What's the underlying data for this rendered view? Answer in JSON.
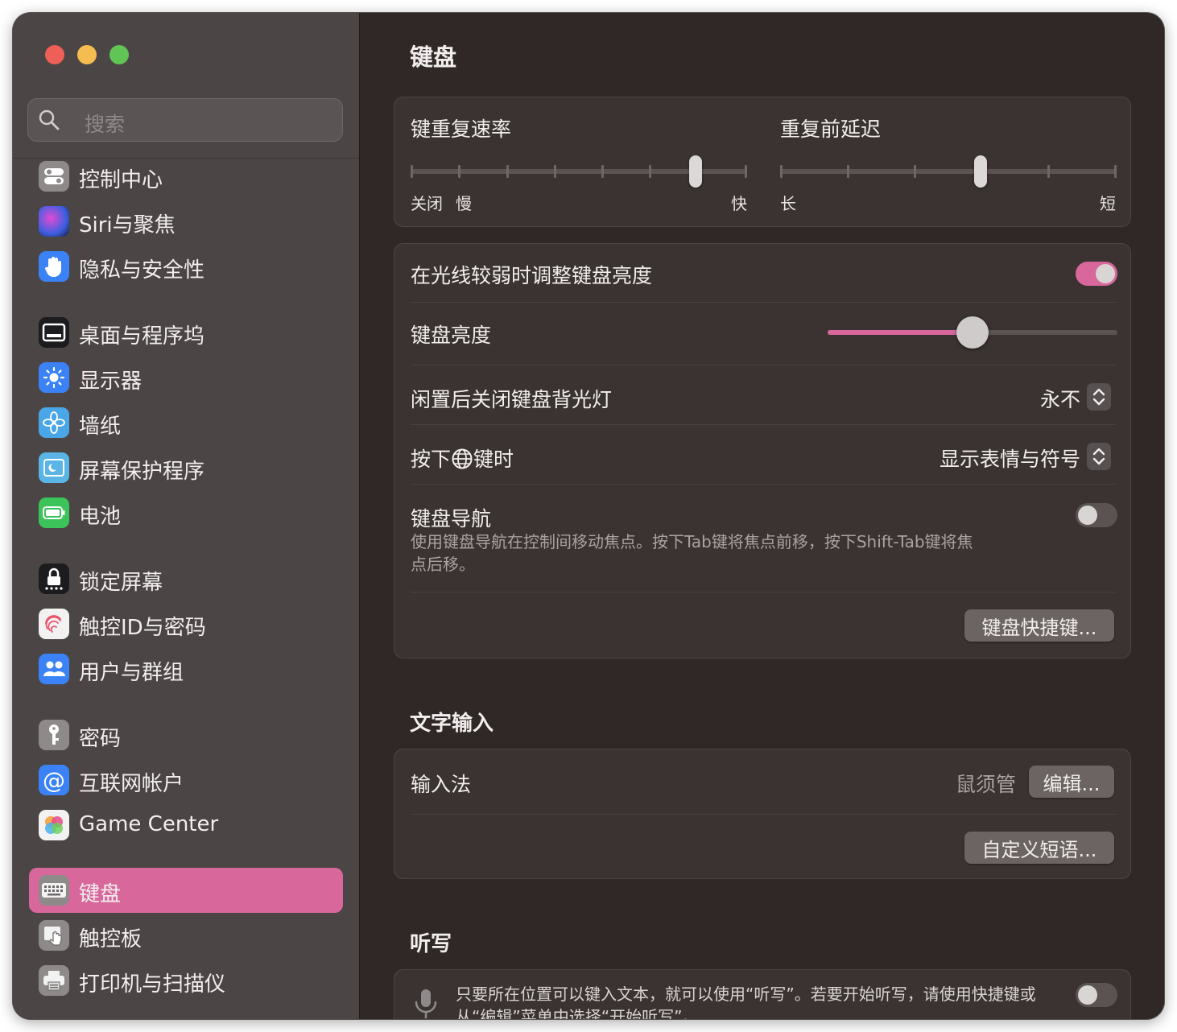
{
  "search": {
    "placeholder": "搜索"
  },
  "sidebar": {
    "items": [
      {
        "label": "控制中心",
        "icon": "control-center-icon",
        "color": "#8e8a89"
      },
      {
        "label": "Siri与聚焦",
        "icon": "siri-icon",
        "color": "#6a3fd6"
      },
      {
        "label": "隐私与安全性",
        "icon": "hand-icon",
        "color": "#3b82f6"
      },
      {
        "label": "桌面与程序坞",
        "icon": "dock-icon",
        "color": "#1c1c1e"
      },
      {
        "label": "显示器",
        "icon": "sun-icon",
        "color": "#3b82f6"
      },
      {
        "label": "墙纸",
        "icon": "flower-icon",
        "color": "#4aa6e6"
      },
      {
        "label": "屏幕保护程序",
        "icon": "screensaver-icon",
        "color": "#5ab4e6"
      },
      {
        "label": "电池",
        "icon": "battery-icon",
        "color": "#3cc35a"
      },
      {
        "label": "锁定屏幕",
        "icon": "lock-icon",
        "color": "#1c1c1e"
      },
      {
        "label": "触控ID与密码",
        "icon": "fingerprint-icon",
        "color": "#f2f2f2"
      },
      {
        "label": "用户与群组",
        "icon": "users-icon",
        "color": "#3b82f6"
      },
      {
        "label": "密码",
        "icon": "key-icon",
        "color": "#8e8a89"
      },
      {
        "label": "互联网帐户",
        "icon": "at-icon",
        "color": "#3b82f6"
      },
      {
        "label": "Game Center",
        "icon": "game-center-icon",
        "color": "#f2f2f2"
      },
      {
        "label": "键盘",
        "icon": "keyboard-icon",
        "color": "#8e8a89"
      },
      {
        "label": "触控板",
        "icon": "trackpad-icon",
        "color": "#8e8a89"
      },
      {
        "label": "打印机与扫描仪",
        "icon": "printer-icon",
        "color": "#8e8a89"
      }
    ]
  },
  "main": {
    "title": "键盘",
    "repeat": {
      "rate_label": "键重复速率",
      "rate_off": "关闭",
      "rate_slow": "慢",
      "rate_fast": "快",
      "rate_level": 0.86,
      "delay_label": "重复前延迟",
      "delay_long": "长",
      "delay_short": "短",
      "delay_level": 0.6
    },
    "backlight": {
      "auto_label": "在光线较弱时调整键盘亮度",
      "auto_on": true,
      "brightness_label": "键盘亮度",
      "brightness_level": 0.5,
      "idle_label": "闲置后关闭键盘背光灯",
      "idle_value": "永不",
      "globe_label_pre": "按下",
      "globe_label_post": "键时",
      "globe_value": "显示表情与符号",
      "nav_label": "键盘导航",
      "nav_on": false,
      "nav_desc_1": "使用键盘导航在控制间移动焦点。按下Tab键将焦点前移，按下Shift-Tab键将焦",
      "nav_desc_2": "点后移。",
      "shortcuts_button": "键盘快捷键..."
    },
    "text_input": {
      "section_title": "文字输入",
      "input_label": "输入法",
      "input_value": "鼠须管",
      "edit_button": "编辑...",
      "phrases_button": "自定义短语..."
    },
    "dictation": {
      "section_title": "听写",
      "desc_1": "只要所在位置可以键入文本，就可以使用“听写”。若要开始听写，请使用快捷键或",
      "desc_2": "从“编辑”菜单中选择“开始听写”。",
      "on": false
    }
  },
  "colors": {
    "accent": "#d8679c",
    "sidebar_bg": "#4b4645",
    "main_bg": "#2f2826"
  }
}
